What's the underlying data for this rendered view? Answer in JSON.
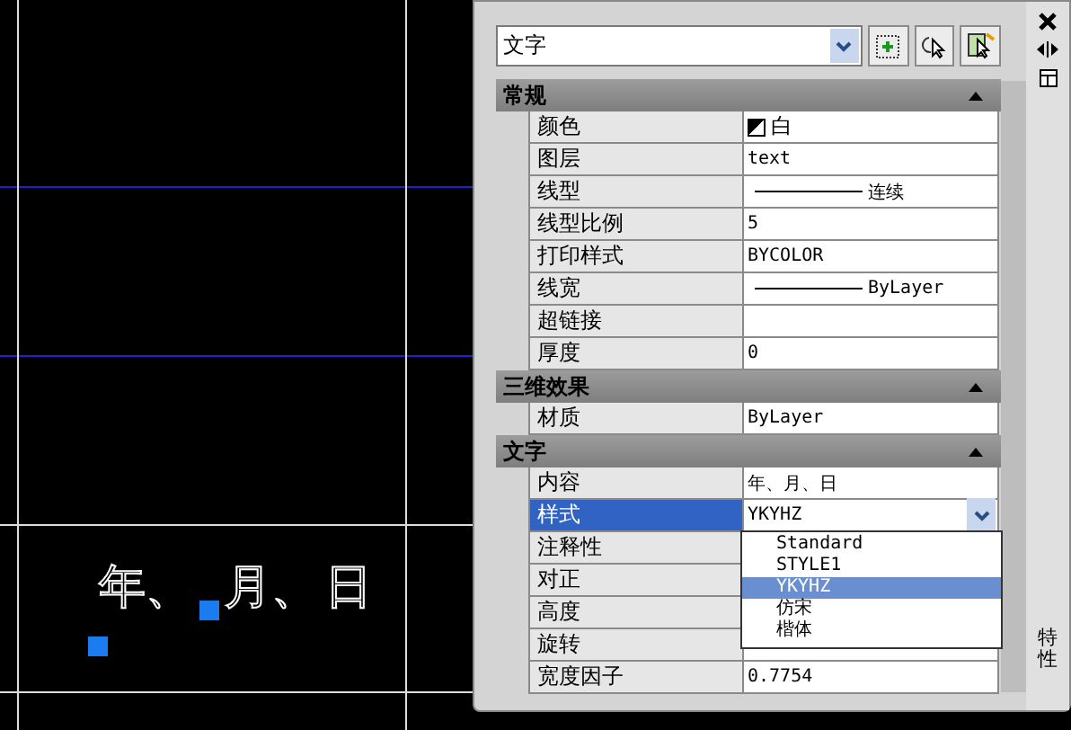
{
  "canvas": {
    "texts": [
      "年、",
      "月、",
      "日"
    ]
  },
  "palette": {
    "title": "特性",
    "object_type": "文字",
    "sections": [
      {
        "title": "常规",
        "expanded": true,
        "rows": [
          {
            "name": "颜色",
            "kind": "color",
            "value": "白",
            "selected": false
          },
          {
            "name": "图层",
            "kind": "text",
            "value": "text",
            "selected": false
          },
          {
            "name": "线型",
            "kind": "line",
            "value": "连续",
            "selected": false
          },
          {
            "name": "线型比例",
            "kind": "text",
            "value": "5",
            "selected": false
          },
          {
            "name": "打印样式",
            "kind": "text",
            "value": "BYCOLOR",
            "selected": false
          },
          {
            "name": "线宽",
            "kind": "line",
            "value": "ByLayer",
            "selected": false
          },
          {
            "name": "超链接",
            "kind": "text",
            "value": "",
            "selected": false
          },
          {
            "name": "厚度",
            "kind": "text",
            "value": "0",
            "selected": false
          }
        ]
      },
      {
        "title": "三维效果",
        "expanded": true,
        "rows": [
          {
            "name": "材质",
            "kind": "text",
            "value": "ByLayer",
            "selected": false
          }
        ]
      },
      {
        "title": "文字",
        "expanded": true,
        "rows": [
          {
            "name": "内容",
            "kind": "text",
            "value": "年、月、日",
            "selected": false
          },
          {
            "name": "样式",
            "kind": "dropdown",
            "value": "YKYHZ",
            "selected": true,
            "options": [
              {
                "label": "Standard",
                "selected": false
              },
              {
                "label": "STYLE1",
                "selected": false
              },
              {
                "label": "YKYHZ",
                "selected": true
              },
              {
                "label": "仿宋",
                "selected": false
              },
              {
                "label": "楷体",
                "selected": false
              }
            ]
          },
          {
            "name": "注释性",
            "kind": "text",
            "value": "",
            "selected": false
          },
          {
            "name": "对正",
            "kind": "text",
            "value": "",
            "selected": false
          },
          {
            "name": "高度",
            "kind": "text",
            "value": "",
            "selected": false
          },
          {
            "name": "旋转",
            "kind": "text",
            "value": "",
            "selected": false
          },
          {
            "name": "宽度因子",
            "kind": "text",
            "value": "0.7754",
            "selected": false
          }
        ]
      }
    ]
  }
}
